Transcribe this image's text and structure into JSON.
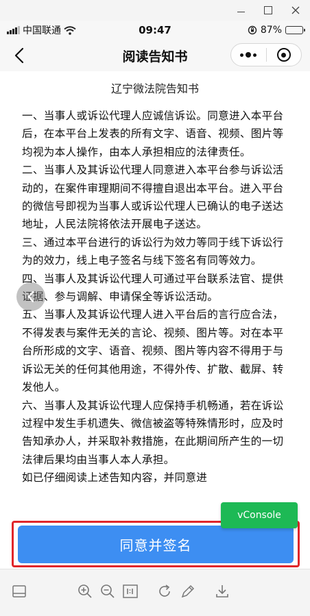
{
  "status_bar": {
    "carrier": "中国联通",
    "time": "09:47",
    "battery_percent": "87%",
    "battery_level": 0.87
  },
  "nav": {
    "title": "阅读告知书"
  },
  "document": {
    "title": "辽宁微法院告知书",
    "paragraphs": [
      "一、当事人或诉讼代理人应诚信诉讼。同意进入本平台后，在本平台上发表的所有文字、语音、视频、图片等均视为本人操作，由本人承担相应的法律责任。",
      "二、当事人及其诉讼代理人同意进入本平台参与诉讼活动的，在案件审理期间不得擅自退出本平台。进入平台的微信号即视为当事人或诉讼代理人已确认的电子送达地址，人民法院将依法开展电子送达。",
      "三、通过本平台进行的诉讼行为效力等同于线下诉讼行为的效力，线上电子签名与线下签名有同等效力。",
      "四、当事人及其诉讼代理人可通过平台联系法官、提供证据、参与调解、申请保全等诉讼活动。",
      "五、当事人及其诉讼代理人进入平台后的言行应合法，不得发表与案件无关的言论、视频、图片等。对在本平台所形成的文字、语音、视频、图片等内容不得用于与诉讼无关的任何其他用途，不得外传、扩散、截屏、转发他人。",
      "六、当事人及其诉讼代理人应保持手机畅通，若在诉讼过程中发生手机遗失、微信被盗等特殊情形时，应及时告知承办人，并采取补救措施，在此期间所产生的一切法律后果均由当事人本人承担。",
      "如已仔细阅读上述告知内容，并同意进"
    ]
  },
  "agree_button": {
    "label": "同意并签名"
  },
  "vconsole": {
    "label": "vConsole"
  },
  "colors": {
    "accent": "#3d8ef2",
    "highlight": "#e0262b",
    "vconsole": "#1db955"
  },
  "icons": {
    "toolbar": [
      "panel-icon",
      "zoom-in-icon",
      "zoom-out-icon",
      "actual-size-icon",
      "rotate-icon",
      "pen-icon",
      "download-icon"
    ]
  }
}
